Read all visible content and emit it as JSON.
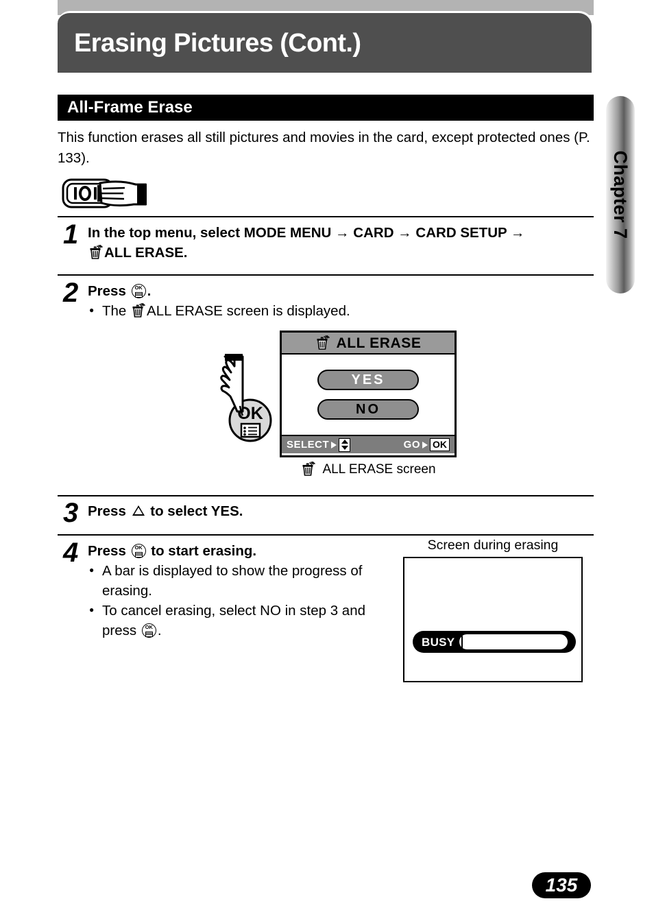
{
  "header": {
    "title": "Erasing Pictures (Cont.)"
  },
  "chapter_tab": {
    "label": "Chapter 7"
  },
  "section": {
    "title": "All-Frame Erase",
    "intro": "This function erases all still pictures and movies in the card, except protected ones (P. 133)."
  },
  "mode_icon": {
    "name": "camera-mode-dial-hand-icon"
  },
  "steps": [
    {
      "number": "1",
      "head_prefix": "In the top menu, select MODE MENU",
      "arrow": "→",
      "seg2": "CARD",
      "seg3": "CARD SETUP",
      "trailing": "ALL ERASE."
    },
    {
      "number": "2",
      "head_prefix": "Press",
      "head_suffix": ".",
      "bullets": [
        {
          "pre": "The",
          "icon": "trash-icon",
          "post": "ALL ERASE screen is displayed."
        }
      ]
    },
    {
      "number": "3",
      "head_prefix": "Press",
      "head_suffix": "to select YES."
    },
    {
      "number": "4",
      "head_prefix": "Press",
      "head_suffix": "to start erasing.",
      "bullets": [
        {
          "text": "A bar is displayed to show the progress of erasing."
        },
        {
          "pre": "To cancel erasing, select NO in step 3 and press",
          "post": "."
        }
      ]
    }
  ],
  "lcd": {
    "title": "ALL ERASE",
    "title_icon": "trash-icon",
    "buttons": [
      {
        "label": "YES",
        "state": "selected"
      },
      {
        "label": "NO",
        "state": "unselected"
      }
    ],
    "status": {
      "select_label": "SELECT",
      "select_arrow": "➜",
      "select_control": "updown-pad-icon",
      "go_label": "GO",
      "go_arrow": "➜",
      "go_control": "OK"
    },
    "caption": "ALL ERASE screen",
    "caption_icon": "trash-icon"
  },
  "busy_screen": {
    "caption": "Screen during erasing",
    "label": "BUSY",
    "progress_percent": 100
  },
  "footer": {
    "page_number": "135"
  },
  "colors": {
    "header_band": "#b3b3b3",
    "header_bar": "#4f4f4f",
    "section_bar": "#000000",
    "lcd_title_bg": "#9a9a9a",
    "lcd_button_bg": "#8f8f8f",
    "lcd_status_bg": "#7d7d7d",
    "busy_fill": "#4d4d4d",
    "page_pill": "#000000"
  }
}
